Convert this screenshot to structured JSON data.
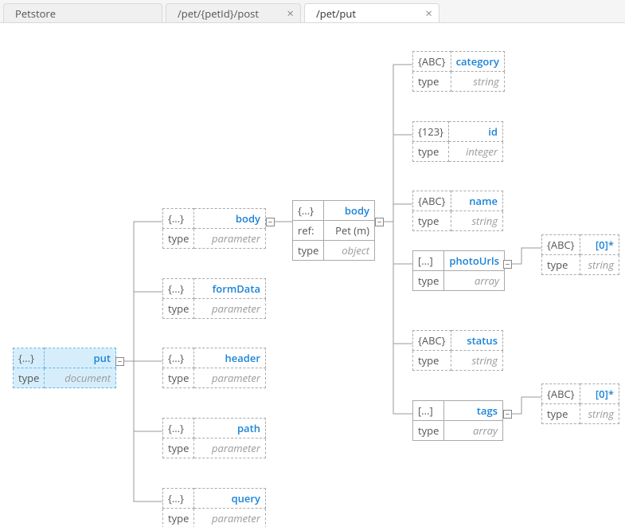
{
  "tabs": {
    "root": "Petstore",
    "inactive": "/pet/{petId}/post",
    "active": "/pet/put",
    "close": "×"
  },
  "toggle": "−",
  "icons": {
    "obj": "{...}",
    "num": "{123}",
    "str": "{ABC}",
    "arr": "[...]"
  },
  "labels": {
    "type": "type",
    "ref": "ref:"
  },
  "types": {
    "document": "document",
    "parameter": "parameter",
    "object": "object",
    "string": "string",
    "integer": "integer",
    "array": "array"
  },
  "n": {
    "root": {
      "name": "put"
    },
    "p_body": {
      "name": "body"
    },
    "p_formData": {
      "name": "formData"
    },
    "p_header": {
      "name": "header"
    },
    "p_path": {
      "name": "path"
    },
    "p_query": {
      "name": "query"
    },
    "body": {
      "name": "body",
      "ref": "Pet (m)"
    },
    "category": {
      "name": "category"
    },
    "id": {
      "name": "id"
    },
    "name": {
      "name": "name"
    },
    "photoUrls": {
      "name": "photoUrls"
    },
    "status": {
      "name": "status"
    },
    "tags": {
      "name": "tags"
    },
    "photoItem": {
      "name": "[0]*"
    },
    "tagItem": {
      "name": "[0]*"
    }
  }
}
